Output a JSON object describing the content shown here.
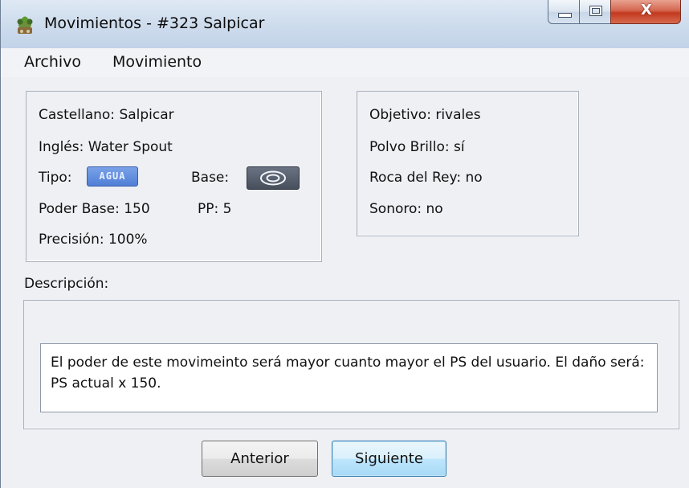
{
  "window": {
    "title": "Movimientos - #323 Salpicar",
    "close_label": "X"
  },
  "menu": {
    "items": [
      "Archivo",
      "Movimiento"
    ]
  },
  "info": {
    "castellano": "Castellano:  Salpicar",
    "ingles": "Inglés:  Water Spout",
    "tipo_label": "Tipo:",
    "tipo_value": "AGUA",
    "base_label": "Base:",
    "base_icon": "special-category-icon",
    "poder_base": "Poder Base:  150",
    "pp": "PP:  5",
    "precision": "Precisión:  100%"
  },
  "flags": {
    "objetivo": "Objetivo: rivales",
    "polvo_brillo": "Polvo Brillo:  sí",
    "roca_del_rey": "Roca del Rey:  no",
    "sonoro": "Sonoro:  no"
  },
  "description": {
    "label": "Descripción:",
    "text": "El poder de este movimeinto será mayor cuanto mayor el PS del usuario. El daño será: PS actual x 150."
  },
  "buttons": {
    "prev": "Anterior",
    "next": "Siguiente"
  },
  "colors": {
    "tipo_badge": "#5b86da",
    "base_badge": "#4f5866",
    "close_button": "#c2391f"
  }
}
